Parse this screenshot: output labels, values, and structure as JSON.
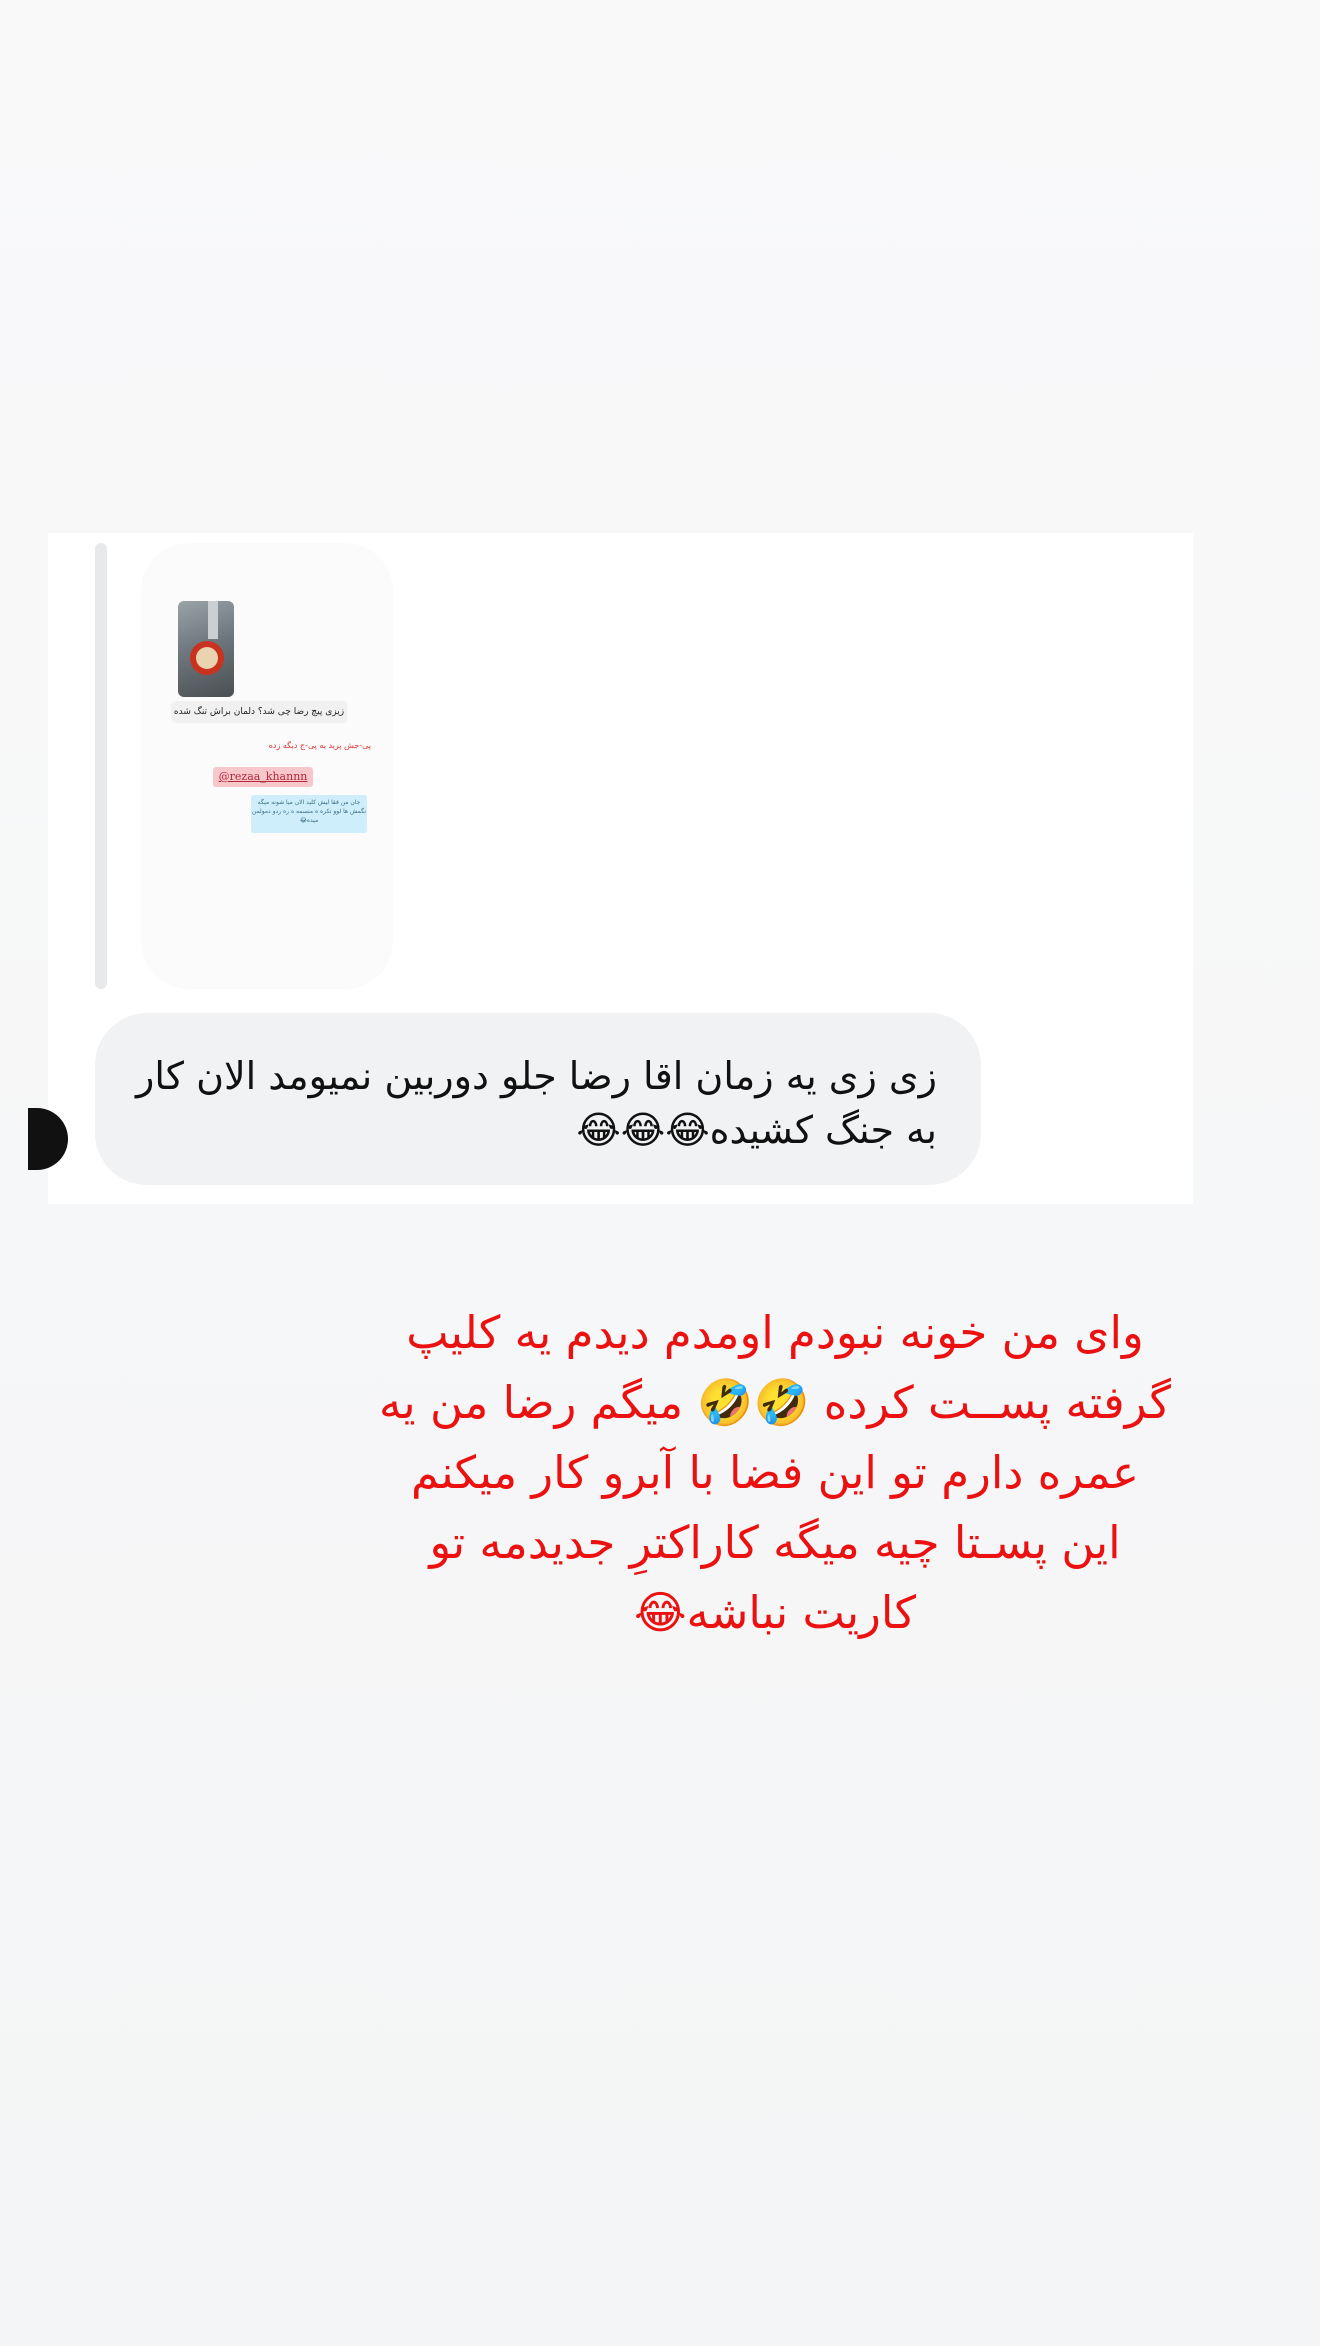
{
  "story": {
    "screenshot": {
      "shared_story": {
        "caption": "زیزی پیچ رضا چی شد؟ دلمان براش تنگ شده",
        "red_line": "پی-جش پرید یه پی-ج دیگه زده",
        "mention": "@rezaa_khannn",
        "cyan_note": "جان من فقا لیش کلید الان میا شونه میگه نگمش ها لوو تکره ه منسمه ه ره ردو دمولمن میده😂"
      },
      "reply_message": "زی زی یه زمان اقا رضا جلو دوربین نمیومد الان کار به جنگ کشیده😂😂😂"
    },
    "overlay_text": "وای من خونه نبودم اومدم دیدم یه کلیپ گرفته پســت کرده 🤣🤣 میگم رضا من یه عمره دارم تو این فضا با آبرو کار میکنم این پسـتا چیه میگه کاراکترِ جدیدمه تو کاریت نباشه😂",
    "colors": {
      "overlay_text": "#ec1111",
      "reply_bubble": "#f1f2f4",
      "card_background": "#ffffff",
      "page_background": "#f6f7f8"
    }
  }
}
